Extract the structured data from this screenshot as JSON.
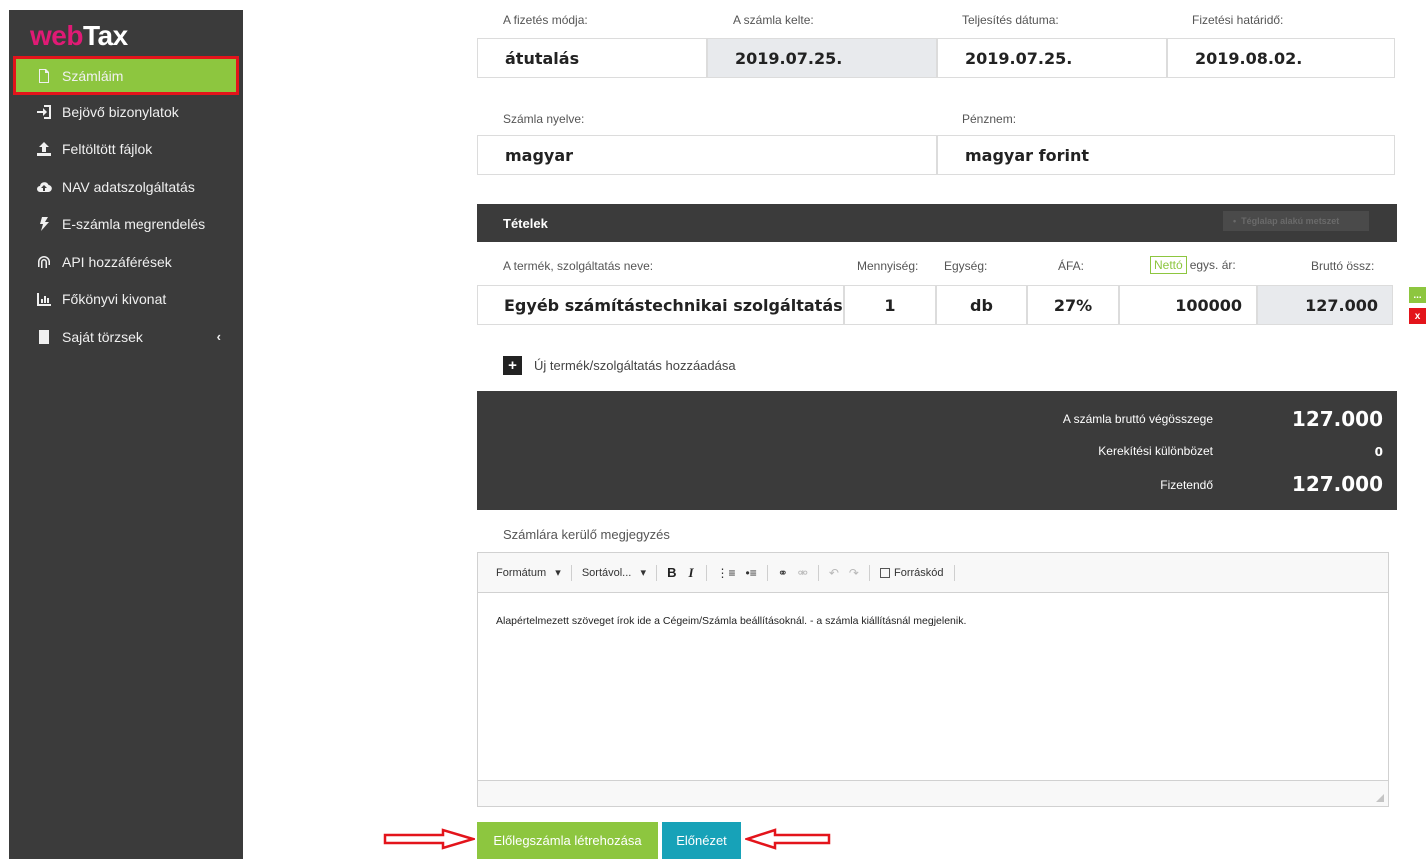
{
  "app": {
    "logo_web": "web",
    "logo_tax": "Tax",
    "brand_color": "#e01a75",
    "accent_color": "#8dc63f",
    "highlight_color": "#e3141b"
  },
  "sidebar": {
    "items": [
      {
        "label": "Számláim",
        "icon": "document-icon",
        "active": true
      },
      {
        "label": "Bejövő bizonylatok",
        "icon": "sign-in-icon"
      },
      {
        "label": "Feltöltött fájlok",
        "icon": "upload-icon"
      },
      {
        "label": "NAV adatszolgáltatás",
        "icon": "cloud-upload-icon"
      },
      {
        "label": "E-számla megrendelés",
        "icon": "bolt-icon"
      },
      {
        "label": "API hozzáférések",
        "icon": "fingerprint-icon"
      },
      {
        "label": "Főkönyvi kivonat",
        "icon": "bar-chart-icon"
      },
      {
        "label": "Saját törzsek",
        "icon": "book-icon",
        "chevron": "‹"
      }
    ]
  },
  "invoice": {
    "payment_method_label": "A fizetés módja:",
    "payment_method": "átutalás",
    "issue_date_label": "A számla kelte:",
    "issue_date": "2019.07.25.",
    "fulfillment_date_label": "Teljesítés dátuma:",
    "fulfillment_date": "2019.07.25.",
    "due_date_label": "Fizetési határidő:",
    "due_date": "2019.08.02.",
    "language_label": "Számla nyelve:",
    "language": "magyar",
    "currency_label": "Pénznem:",
    "currency": "magyar forint"
  },
  "items": {
    "header": "Tételek",
    "ghost_text": "Téglalap alakú metszet",
    "columns": {
      "name": "A termék, szolgáltatás neve:",
      "quantity": "Mennyiség:",
      "unit": "Egység:",
      "vat": "ÁFA:",
      "net_badge": "Nettó",
      "net_price": "egys. ár:",
      "gross": "Bruttó össz:"
    },
    "rows": [
      {
        "name": "Egyéb számítástechnikai szolgáltatás",
        "quantity": "1",
        "unit": "db",
        "vat": "27%",
        "net_price": "100000",
        "gross": "127.000"
      }
    ],
    "row_more": "...",
    "row_delete": "x",
    "add_label": "Új termék/szolgáltatás hozzáadása",
    "add_icon": "+"
  },
  "totals": {
    "gross_label": "A számla bruttó végösszege",
    "gross_value": "127.000",
    "rounding_label": "Kerekítési különbözet",
    "rounding_value": "0",
    "payable_label": "Fizetendő",
    "payable_value": "127.000"
  },
  "notes": {
    "label": "Számlára kerülő megjegyzés",
    "toolbar": {
      "format": "Formátum",
      "spacing": "Sortávol...",
      "bold": "B",
      "italic": "I",
      "source": "Forráskód"
    },
    "content": "Alapértelmezett szöveget írok ide a Cégeim/Számla beállításoknál. - a számla kiállításnál megjelenik."
  },
  "actions": {
    "advance_invoice": "Előlegszámla létrehozása",
    "preview": "Előnézet"
  }
}
